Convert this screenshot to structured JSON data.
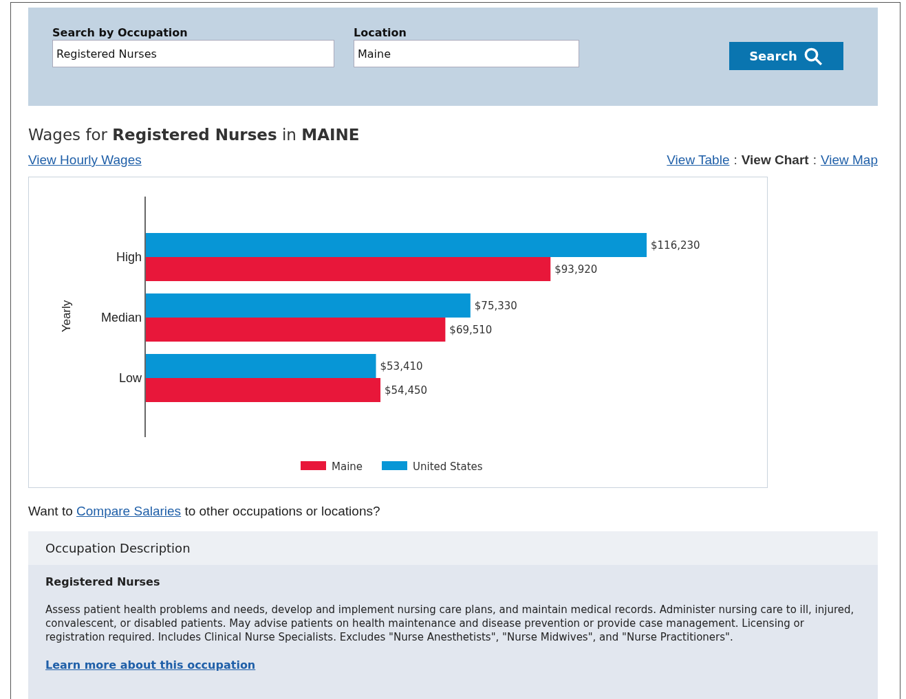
{
  "search": {
    "fields": [
      {
        "label": "Search by Occupation",
        "value": "Registered Nurses"
      },
      {
        "label": "Location",
        "value": "Maine"
      }
    ],
    "button": "Search"
  },
  "heading": "Wages for **Registered Nurses** in **MAINE**",
  "hourly_link": "View Hourly Wages",
  "views": [
    {
      "label": "View Table",
      "selected": false
    },
    {
      "label": "View Chart",
      "selected": true
    },
    {
      "label": "View Map",
      "selected": false
    }
  ],
  "view_separators": [
    ":",
    ":"
  ],
  "chart": {
    "chart_data": {
      "type": "bar",
      "orientation": "horizontal",
      "ylabel": "Yearly",
      "categories": [
        "High",
        "Median",
        "Low"
      ],
      "legend": "bottom",
      "series": [
        {
          "name": "Maine",
          "color": "#e8173a",
          "values": [
            93920,
            69510,
            54450
          ],
          "value_labels": [
            "$93,920",
            "$69,510",
            "$54,450"
          ]
        },
        {
          "name": "United States",
          "color": "#0796d6",
          "values": [
            116230,
            75330,
            53410
          ],
          "value_labels": [
            "$116,230",
            "$75,330",
            "$53,410"
          ]
        }
      ]
    }
  },
  "compare": {
    "before": "Want to",
    "link": "Compare Salaries",
    "after": "to other occupations or locations?"
  },
  "description": {
    "title": "Occupation Description",
    "name": "Registered Nurses",
    "text": "Assess patient health problems and needs, develop and implement nursing care plans, and maintain medical records. Administer nursing care to ill, injured, convalescent, or disabled patients. May advise patients on health maintenance and disease prevention or provide case management. Licensing or registration required. Includes Clinical Nurse Specialists. Excludes \"Nurse Anesthetists\", \"Nurse Midwives\", and \"Nurse Practitioners\".",
    "link": "Learn more about this occupation"
  }
}
